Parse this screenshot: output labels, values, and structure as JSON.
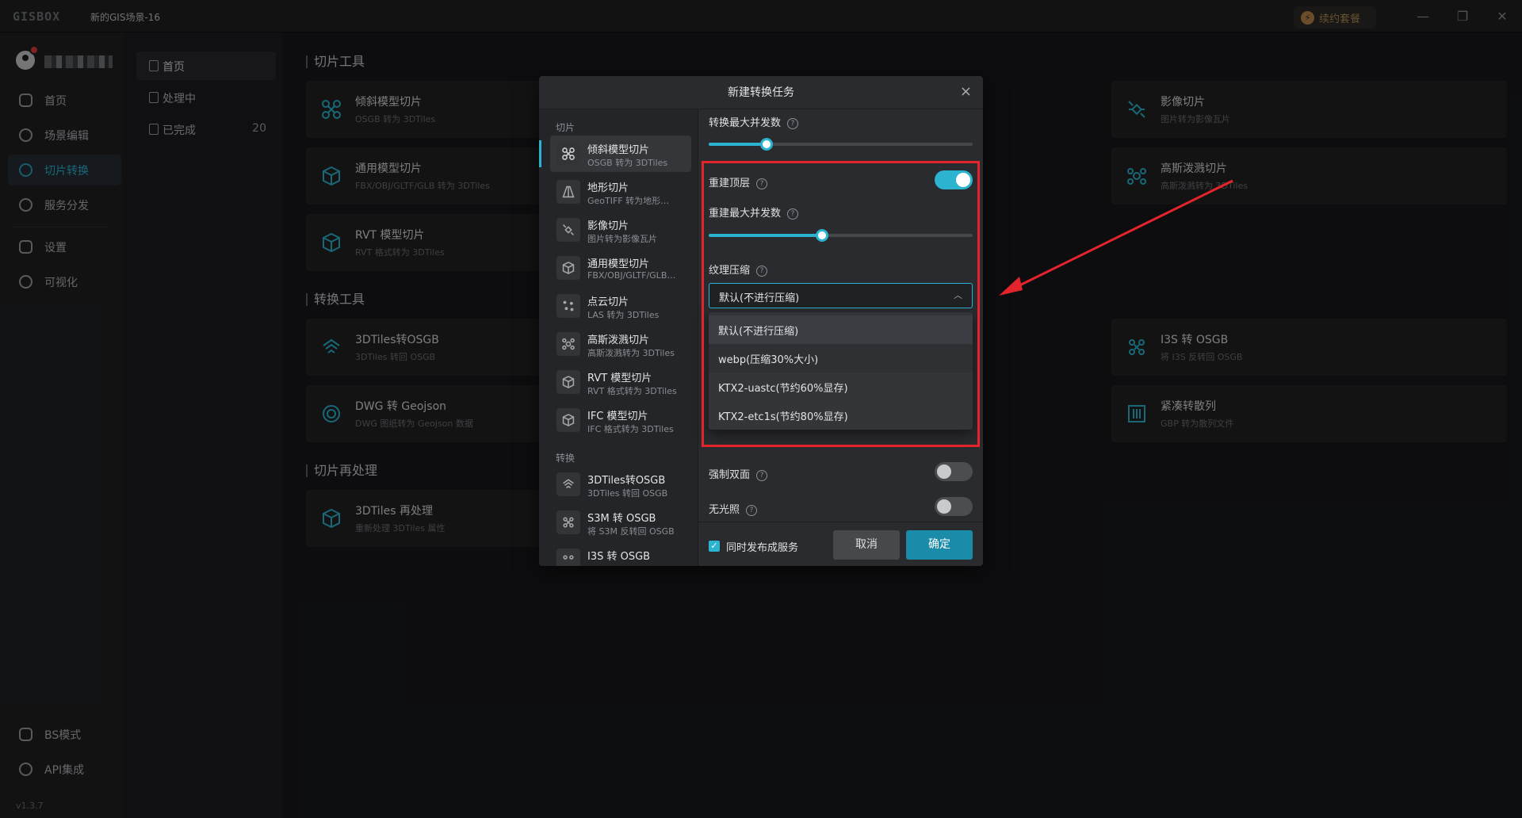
{
  "app": {
    "logo": "GISBOX",
    "window_title": "新的GIS场景-16",
    "vip_label": "续约套餐",
    "win_min": "—",
    "win_max": "❐",
    "win_close": "✕"
  },
  "sidebar": {
    "items": [
      {
        "label": "首页"
      },
      {
        "label": "场景编辑"
      },
      {
        "label": "切片转换"
      },
      {
        "label": "服务分发"
      },
      {
        "label": "设置"
      },
      {
        "label": "可视化"
      }
    ],
    "bottom": [
      {
        "label": "BS模式"
      },
      {
        "label": "API集成"
      }
    ],
    "version": "v1.3.7"
  },
  "subnav": {
    "items": [
      {
        "label": "首页"
      },
      {
        "label": "处理中"
      },
      {
        "label": "已完成",
        "count": "20"
      }
    ]
  },
  "main": {
    "sections": [
      "切片工具",
      "转换工具",
      "切片再处理"
    ],
    "cards": [
      {
        "title": "倾斜模型切片",
        "sub": "OSGB 转为 3DTiles"
      },
      {
        "title": "影像切片",
        "sub": "图片转为影像瓦片"
      },
      {
        "title": "通用模型切片",
        "sub": "FBX/OBJ/GLTF/GLB 转为 3DTiles"
      },
      {
        "title": "高斯泼溅切片",
        "sub": "高斯泼溅转为 3DTiles"
      },
      {
        "title": "RVT 模型切片",
        "sub": "RVT 格式转为 3DTiles"
      },
      {
        "title": "3DTiles转OSGB",
        "sub": "3DTiles 转回 OSGB"
      },
      {
        "title": "I3S 转 OSGB",
        "sub": "将 I3S 反转回 OSGB"
      },
      {
        "title": "DWG 转 Geojson",
        "sub": "DWG 图纸转为 Geojson 数据"
      },
      {
        "title": "紧凑转散列",
        "sub": "GBP 转为散列文件"
      },
      {
        "title": "3DTiles 再处理",
        "sub": "重新处理 3DTiles 属性"
      }
    ]
  },
  "dialog": {
    "title": "新建转换任务",
    "close": "×",
    "groups": [
      "切片",
      "转换"
    ],
    "list": [
      {
        "title": "倾斜模型切片",
        "sub": "OSGB 转为 3DTiles"
      },
      {
        "title": "地形切片",
        "sub": "GeoTIFF 转为地形…"
      },
      {
        "title": "影像切片",
        "sub": "图片转为影像瓦片"
      },
      {
        "title": "通用模型切片",
        "sub": "FBX/OBJ/GLTF/GLB…"
      },
      {
        "title": "点云切片",
        "sub": "LAS 转为 3DTiles"
      },
      {
        "title": "高斯泼溅切片",
        "sub": "高斯泼溅转为 3DTiles"
      },
      {
        "title": "RVT 模型切片",
        "sub": "RVT 格式转为 3DTiles"
      },
      {
        "title": "IFC 模型切片",
        "sub": "IFC 格式转为 3DTiles"
      },
      {
        "title": "3DTiles转OSGB",
        "sub": "3DTiles 转回 OSGB"
      },
      {
        "title": "S3M 转 OSGB",
        "sub": "将 S3M 反转回 OSGB"
      },
      {
        "title": "I3S 转 OSGB",
        "sub": ""
      }
    ],
    "form": {
      "max_concurrency_label": "转换最大并发数",
      "max_concurrency_value": 0.22,
      "rebuild_top_label": "重建顶层",
      "rebuild_top_on": true,
      "rebuild_concurrency_label": "重建最大并发数",
      "rebuild_concurrency_value": 0.43,
      "texture_label": "纹理压缩",
      "texture_selected": "默认(不进行压缩)",
      "texture_options": [
        "默认(不进行压缩)",
        "webp(压缩30%大小)",
        "KTX2-uastc(节约60%显存)",
        "KTX2-etc1s(节约80%显存)"
      ],
      "double_side_label": "强制双面",
      "double_side_on": false,
      "no_light_label": "无光照",
      "no_light_on": false
    },
    "footer": {
      "publish_label": "同时发布成服务",
      "cancel": "取消",
      "ok": "确定"
    }
  },
  "colors": {
    "accent": "#2bb3cf",
    "highlight": "#e3242b"
  }
}
